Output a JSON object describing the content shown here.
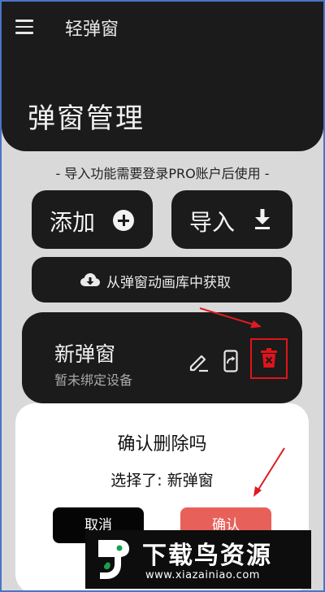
{
  "app": {
    "title": "轻弹窗"
  },
  "header": {
    "title": "弹窗管理"
  },
  "notice": "- 导入功能需要登录PRO账户后使用 -",
  "actions": {
    "add_label": "添加",
    "import_label": "导入",
    "library_label": "从弹窗动画库中获取"
  },
  "popup_item": {
    "name": "新弹窗",
    "subtitle": "暂未绑定设备"
  },
  "dialog": {
    "title": "确认删除吗",
    "message": "选择了: 新弹窗",
    "cancel_label": "取消",
    "confirm_label": "确认"
  },
  "watermark": {
    "title": "下载鸟资源",
    "url": "www.xiazainiao.com"
  },
  "icons": {
    "menu": "menu-icon",
    "add": "plus-circle-icon",
    "import": "download-icon",
    "library": "cloud-download-icon",
    "edit": "pencil-icon",
    "share": "share-icon",
    "delete": "trash-icon"
  },
  "colors": {
    "surface_dark": "#1b1b1b",
    "background": "#d9d9d9",
    "delete_red": "#e0141a",
    "confirm": "#e8605a",
    "annotation_red": "#e01a22"
  }
}
